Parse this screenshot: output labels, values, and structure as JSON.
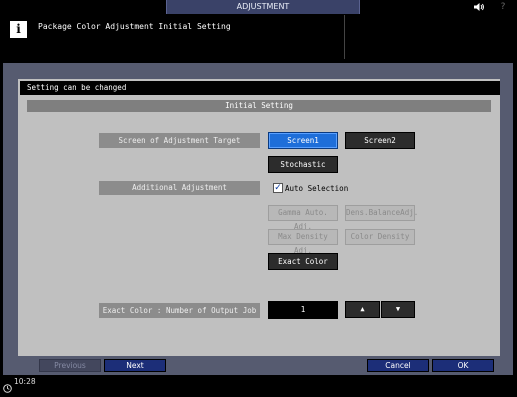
{
  "window": {
    "title": "ADJUSTMENT",
    "speaker_icon": "speaker-icon",
    "help_icon": "help-icon",
    "help_glyph": "?"
  },
  "header": {
    "info_glyph": "i",
    "message": "Package Color Adjustment Initial Setting"
  },
  "dialog": {
    "status": "Setting can be changed",
    "section_title": "Initial Setting",
    "screen_target": {
      "label": "Screen of Adjustment Target",
      "options": [
        "Screen1",
        "Screen2",
        "Stochastic"
      ],
      "selected": "Screen1"
    },
    "additional": {
      "label": "Additional Adjustment",
      "auto_selection_label": "Auto Selection",
      "auto_selection_checked": true,
      "check_glyph": "✓",
      "buttons": {
        "gamma": "Gamma Auto. Adj.",
        "dens_balance": "Dens.BalanceAdj.",
        "max_density": "Max Density Adj.",
        "color_density": "Color Density",
        "exact_color": "Exact Color"
      }
    },
    "output_job": {
      "label": "Exact Color : Number of Output Job",
      "value": "1",
      "up_glyph": "▲",
      "down_glyph": "▼"
    }
  },
  "actions": {
    "previous": "Previous",
    "next": "Next",
    "cancel": "Cancel",
    "ok": "OK"
  },
  "footer": {
    "clock_icon": "clock-icon",
    "time": "10:28"
  },
  "colors": {
    "accent_selected": "#1e6ed9",
    "dialog_frame": "#565b70",
    "action_button": "#1c2e78"
  }
}
